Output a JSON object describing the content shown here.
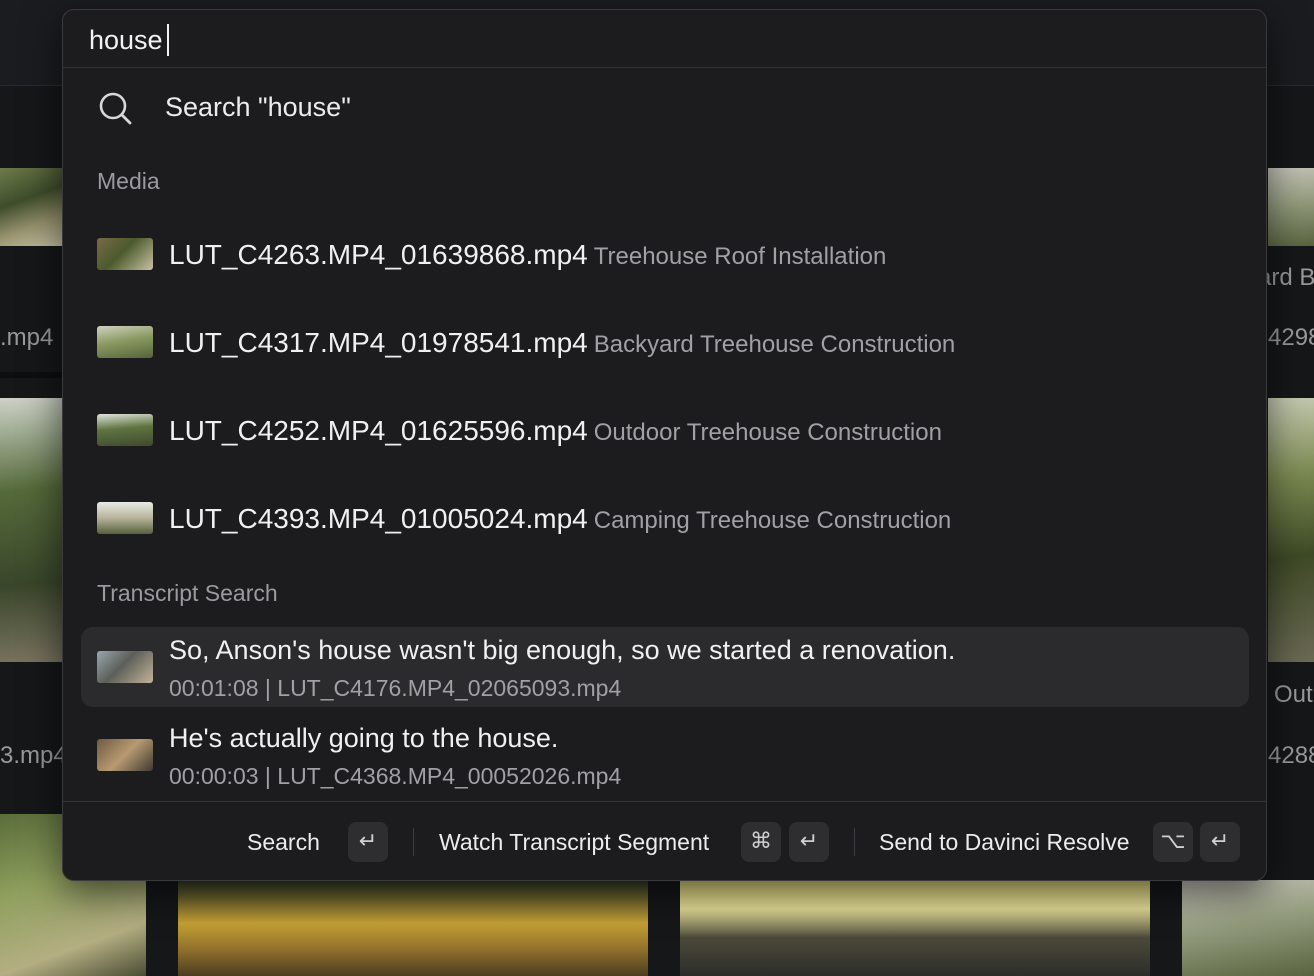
{
  "search": {
    "query": "house",
    "action_label": "Search \"house\""
  },
  "background": {
    "labels": [
      ".mp4",
      "ard B",
      "4298",
      "3.mp4",
      "Out",
      "4288"
    ]
  },
  "sections": {
    "media_title": "Media",
    "transcript_title": "Transcript Search"
  },
  "media": [
    {
      "filename": "LUT_C4263.MP4_01639868.mp4",
      "description": "Treehouse Roof Installation"
    },
    {
      "filename": "LUT_C4317.MP4_01978541.mp4",
      "description": "Backyard Treehouse Construction"
    },
    {
      "filename": "LUT_C4252.MP4_01625596.mp4",
      "description": "Outdoor Treehouse Construction"
    },
    {
      "filename": "LUT_C4393.MP4_01005024.mp4",
      "description": "Camping Treehouse Construction"
    }
  ],
  "transcripts": [
    {
      "text": "So, Anson's house wasn't big enough, so we started a renovation.",
      "meta": "00:01:08 | LUT_C4176.MP4_02065093.mp4",
      "selected": true
    },
    {
      "text": "He's actually going to the house.",
      "meta": "00:00:03 | LUT_C4368.MP4_00052026.mp4",
      "selected": false
    }
  ],
  "footer": {
    "search_label": "Search",
    "watch_label": "Watch Transcript Segment",
    "send_label": "Send to Davinci Resolve",
    "keys": {
      "enter": "↵",
      "cmd": "⌘",
      "option": "⌥"
    }
  },
  "icons": {
    "search_action": "search-icon",
    "enter_key": "return-key-icon",
    "cmd_key": "command-key-icon",
    "option_key": "option-key-icon"
  }
}
